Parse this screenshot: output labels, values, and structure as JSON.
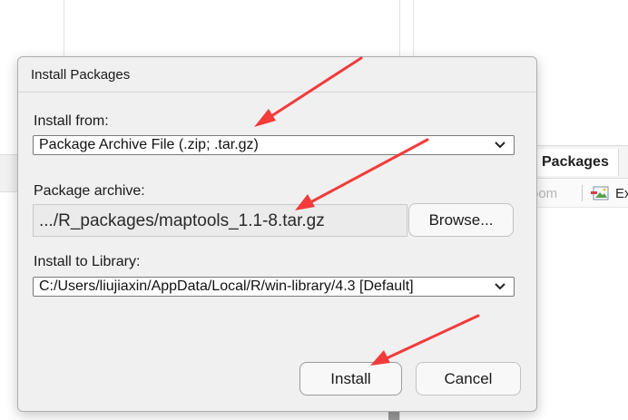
{
  "background": {
    "tab_packages_label": "Packages",
    "toolbar_zoom_label": "oom",
    "toolbar_export_label": "Ex"
  },
  "dialog": {
    "title": "Install Packages",
    "install_from": {
      "label": "Install from:",
      "selected": "Package Archive File (.zip; .tar.gz)"
    },
    "package_archive": {
      "label": "Package archive:",
      "value": ".../R_packages/maptools_1.1-8.tar.gz",
      "browse_label": "Browse..."
    },
    "install_to_library": {
      "label": "Install to Library:",
      "selected": "C:/Users/liujiaxin/AppData/Local/R/win-library/4.3 [Default]"
    },
    "install_label": "Install",
    "cancel_label": "Cancel"
  },
  "colors": {
    "annotation_arrow": "#f23b3b",
    "dialog_background": "#f0f0f0"
  }
}
